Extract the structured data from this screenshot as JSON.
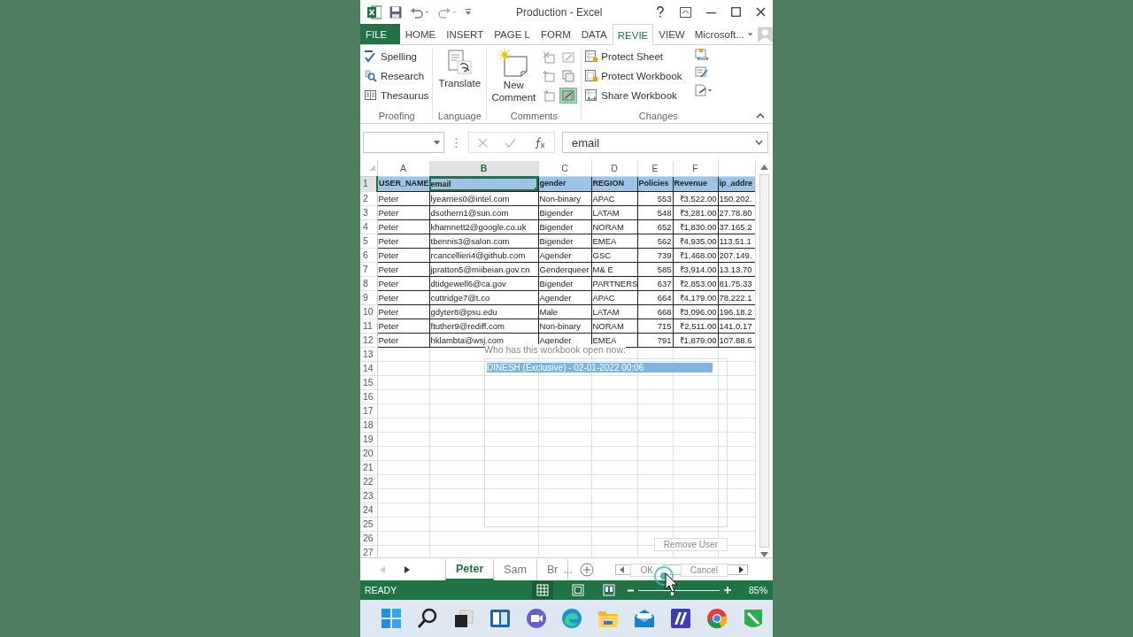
{
  "window": {
    "title": "Production - Excel"
  },
  "ribbon_tabs": [
    {
      "label": "FILE",
      "kind": "file",
      "selected": false
    },
    {
      "label": "HOME",
      "kind": "tab",
      "selected": false
    },
    {
      "label": "INSERT",
      "kind": "tab",
      "selected": false
    },
    {
      "label": "PAGE L",
      "kind": "tab",
      "selected": false
    },
    {
      "label": "FORM",
      "kind": "tab",
      "selected": false
    },
    {
      "label": "DATA",
      "kind": "tab",
      "selected": false
    },
    {
      "label": "REVIE",
      "kind": "tab",
      "selected": true
    },
    {
      "label": "VIEW",
      "kind": "tab",
      "selected": false
    }
  ],
  "account": {
    "name": "Microsoft..."
  },
  "ribbon": {
    "proofing": {
      "label": "Proofing",
      "commands": [
        "Spelling",
        "Research",
        "Thesaurus"
      ]
    },
    "language": {
      "label": "Language",
      "command": "Translate"
    },
    "comments": {
      "label": "Comments",
      "command": "New Comment",
      "tools": [
        {
          "on": false
        },
        {
          "on": false
        },
        {
          "on": false
        },
        {
          "on": false
        },
        {
          "on": false
        },
        {
          "on": true
        }
      ]
    },
    "changes": {
      "label": "Changes",
      "commands": [
        "Protect Sheet",
        "Protect Workbook",
        "Share Workbook"
      ]
    }
  },
  "formula_bar": {
    "formula": "email"
  },
  "columns": [
    {
      "letter": "A",
      "kind": "text",
      "selected": false
    },
    {
      "letter": "B",
      "kind": "text",
      "selected": true
    },
    {
      "letter": "C",
      "kind": "text",
      "selected": false
    },
    {
      "letter": "D",
      "kind": "text",
      "selected": false
    },
    {
      "letter": "E",
      "kind": "number",
      "selected": false
    },
    {
      "letter": "F",
      "kind": "number",
      "selected": false
    },
    {
      "kind": "text",
      "selected": false
    }
  ],
  "rows": [
    {
      "number": "1",
      "kind": "header",
      "selected": true,
      "cells": [
        "USER_NAME",
        "email",
        "gender",
        "REGION",
        "Policies",
        "Revenue",
        "ip_addre"
      ]
    },
    {
      "number": "2",
      "kind": "data",
      "selected": false,
      "cells": [
        "Peter",
        "lyearnes0@intel.com",
        "Non-binary",
        "APAC",
        "553",
        "₹3,522.00",
        "150.202."
      ]
    },
    {
      "number": "3",
      "kind": "data",
      "selected": false,
      "cells": [
        "Peter",
        "dsothern1@sun.com",
        "Bigender",
        "LATAM",
        "548",
        "₹3,281.00",
        "27.78.80"
      ]
    },
    {
      "number": "4",
      "kind": "data",
      "selected": false,
      "cells": [
        "Peter",
        "khamnett2@google.co.uk",
        "Bigender",
        "NORAM",
        "652",
        "₹1,830.00",
        "37.165.2"
      ]
    },
    {
      "number": "5",
      "kind": "data",
      "selected": false,
      "cells": [
        "Peter",
        "tbennis3@salon.com",
        "Bigender",
        "EMEA",
        "562",
        "₹4,935.00",
        "113.51.1"
      ]
    },
    {
      "number": "6",
      "kind": "data",
      "selected": false,
      "cells": [
        "Peter",
        "rcancellieri4@github.com",
        "Agender",
        "GSC",
        "739",
        "₹1,468.00",
        "207.149."
      ]
    },
    {
      "number": "7",
      "kind": "data",
      "selected": false,
      "cells": [
        "Peter",
        "jpratton5@miibeian.gov.cn",
        "Genderqueer",
        "M& E",
        "585",
        "₹3,914.00",
        "13.13.70"
      ]
    },
    {
      "number": "8",
      "kind": "data",
      "selected": false,
      "cells": [
        "Peter",
        "dtidgewell6@ca.gov",
        "Bigender",
        "PARTNERS",
        "637",
        "₹2,853.00",
        "81.75.33"
      ]
    },
    {
      "number": "9",
      "kind": "data",
      "selected": false,
      "cells": [
        "Peter",
        "cuttridge7@t.co",
        "Agender",
        "APAC",
        "664",
        "₹4,179.00",
        "78.222.1"
      ]
    },
    {
      "number": "10",
      "kind": "data",
      "selected": false,
      "cells": [
        "Peter",
        "gdyter8@psu.edu",
        "Male",
        "LATAM",
        "668",
        "₹3,096.00",
        "196.18.2"
      ]
    },
    {
      "number": "11",
      "kind": "data",
      "selected": false,
      "cells": [
        "Peter",
        "ftuther9@rediff.com",
        "Non-binary",
        "NORAM",
        "715",
        "₹2,511.00",
        "141.0.17"
      ]
    },
    {
      "number": "12",
      "kind": "data",
      "selected": false,
      "cells": [
        "Peter",
        "hklambta@wsj.com",
        "Agender",
        "EMEA",
        "791",
        "₹1,879.00",
        "107.88.6"
      ]
    },
    {
      "number": "13",
      "kind": "empty",
      "selected": false
    },
    {
      "number": "14",
      "kind": "empty",
      "selected": false
    },
    {
      "number": "15",
      "kind": "empty",
      "selected": false
    },
    {
      "number": "16",
      "kind": "empty",
      "selected": false
    },
    {
      "number": "17",
      "kind": "empty",
      "selected": false
    },
    {
      "number": "18",
      "kind": "empty",
      "selected": false
    },
    {
      "number": "19",
      "kind": "empty",
      "selected": false
    },
    {
      "number": "20",
      "kind": "empty",
      "selected": false
    },
    {
      "number": "21",
      "kind": "empty",
      "selected": false
    },
    {
      "number": "22",
      "kind": "empty",
      "selected": false
    },
    {
      "number": "23",
      "kind": "empty",
      "selected": false
    },
    {
      "number": "24",
      "kind": "empty",
      "selected": false
    },
    {
      "number": "25",
      "kind": "empty",
      "selected": false
    },
    {
      "number": "26",
      "kind": "empty",
      "selected": false
    },
    {
      "number": "27",
      "kind": "empty",
      "selected": false
    }
  ],
  "sheet_tabs": [
    {
      "label": "Peter",
      "selected": true
    },
    {
      "label": "Sam",
      "selected": false
    },
    {
      "label": "Br",
      "selected": false
    }
  ],
  "sheet_overflow": "...",
  "dialog": {
    "users_label": "Who has this workbook open now:",
    "users": [
      {
        "label": "DINESH (Exclusive) - 02-01-2022 00:06",
        "selected": true
      }
    ],
    "buttons": [
      "Remove User",
      "OK",
      "Cancel"
    ]
  },
  "status_bar": {
    "status": "READY",
    "zoom": "85%",
    "zoom_level": {
      "level": 0.41
    }
  }
}
